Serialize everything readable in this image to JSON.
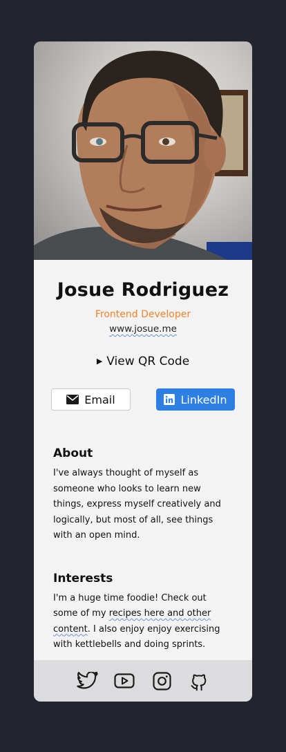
{
  "profile": {
    "name": "Josue Rodriguez",
    "role": "Frontend Developer",
    "website": "www.josue.me",
    "photo_alt": "profile-photo"
  },
  "qr": {
    "label": "View QR Code"
  },
  "buttons": {
    "email_label": "Email",
    "linkedin_label": "LinkedIn"
  },
  "about": {
    "heading": "About",
    "text": "I've always thought of myself as someone who looks to learn new things, express myself creatively and logically, but most of all, see things with an open mind."
  },
  "interests": {
    "heading": "Interests",
    "text_before": "I'm a huge time foodie! Check out some of my ",
    "link": "recipes here and other content",
    "text_after": ". I also enjoy enjoy exercising with kettlebells and doing sprints."
  },
  "footer": {
    "icons": [
      "twitter-icon",
      "youtube-icon",
      "instagram-icon",
      "github-icon"
    ]
  },
  "colors": {
    "background": "#22252d",
    "card": "#f3f3f4",
    "accent": "#f7822a",
    "linkedin": "#2d7fe3",
    "footer": "#dcdcde"
  }
}
